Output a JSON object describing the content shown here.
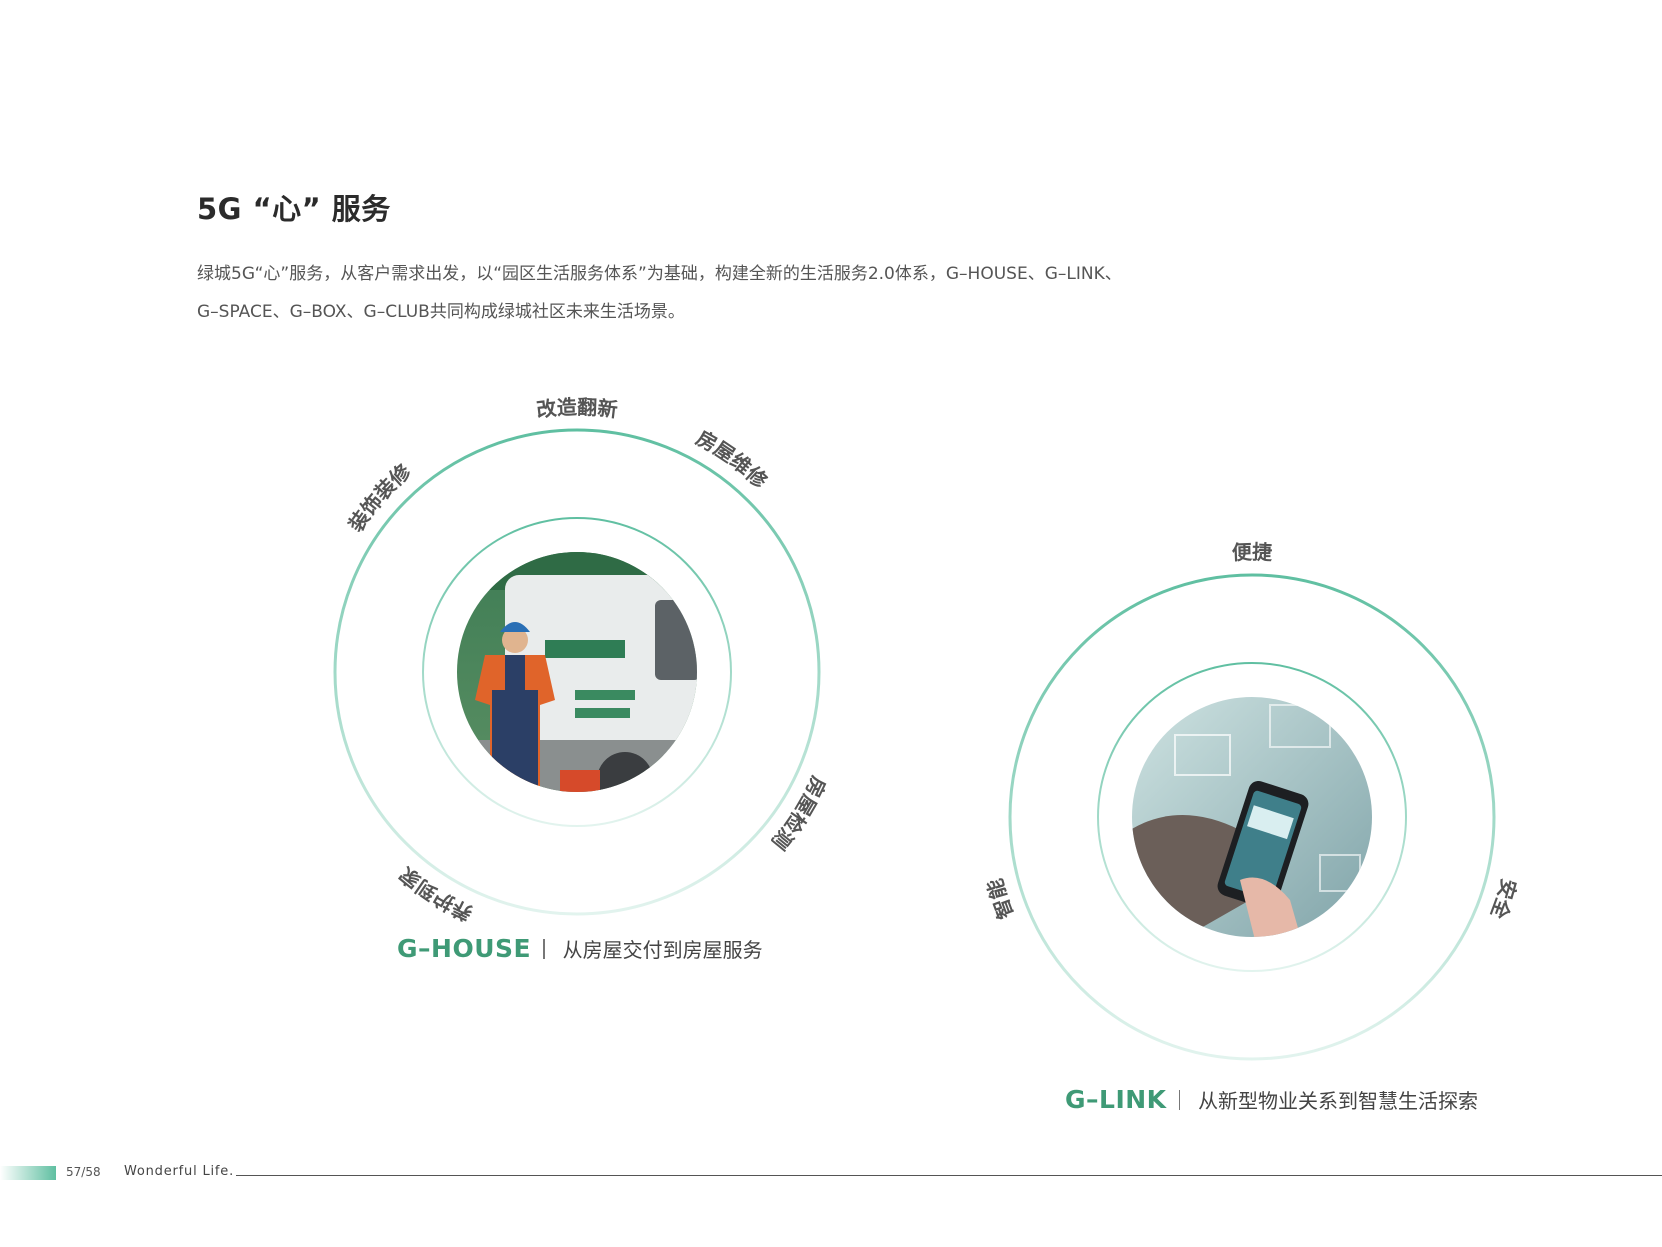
{
  "page": {
    "title": "5G “心” 服务",
    "intro_line1": "绿城5G“心”服务，从客户需求出发，以“园区生活服务体系”为基础，构建全新的生活服务2.0体系，G–HOUSE、G–LINK、",
    "intro_line2": "G–SPACE、G–BOX、G–CLUB共同构成绿城社区未来生活场景。"
  },
  "house": {
    "brand": "G–HOUSE",
    "desc": "从房屋交付到房屋服务",
    "labels": [
      "改造翻新",
      "房屋维修",
      "房屋检测",
      "养护到家",
      "装饰装修"
    ],
    "photo_alt": "worker-with-van-photo"
  },
  "link": {
    "brand": "G–LINK",
    "desc": "从新型物业关系到智慧生活探索",
    "labels": [
      "便捷",
      "安全",
      "智能"
    ],
    "photo_alt": "hand-holding-phone-photo"
  },
  "footer": {
    "page": "57/58",
    "tagline": "Wonderful Life."
  },
  "colors": {
    "accent": "#5fbfa1",
    "brand_text": "#3f9a76"
  }
}
